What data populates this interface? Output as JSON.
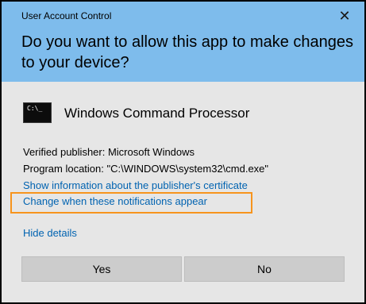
{
  "window": {
    "title": "User Account Control",
    "close_glyph": "✕",
    "question": "Do you want to allow this app to make changes to your device?"
  },
  "app": {
    "icon": "cmd-icon",
    "icon_glyph": "C:\\_",
    "name": "Windows Command Processor"
  },
  "details": {
    "publisher": "Verified publisher: Microsoft Windows",
    "location": "Program location: \"C:\\WINDOWS\\system32\\cmd.exe\"",
    "cert_link": "Show information about the publisher's certificate",
    "notify_link": "Change when these notifications appear",
    "hide_details": "Hide details"
  },
  "buttons": {
    "yes": "Yes",
    "no": "No"
  },
  "colors": {
    "header": "#7ebcec",
    "body": "#e6e6e6",
    "link": "#0063b1",
    "highlight": "#f7941d",
    "button": "#cccccc"
  }
}
